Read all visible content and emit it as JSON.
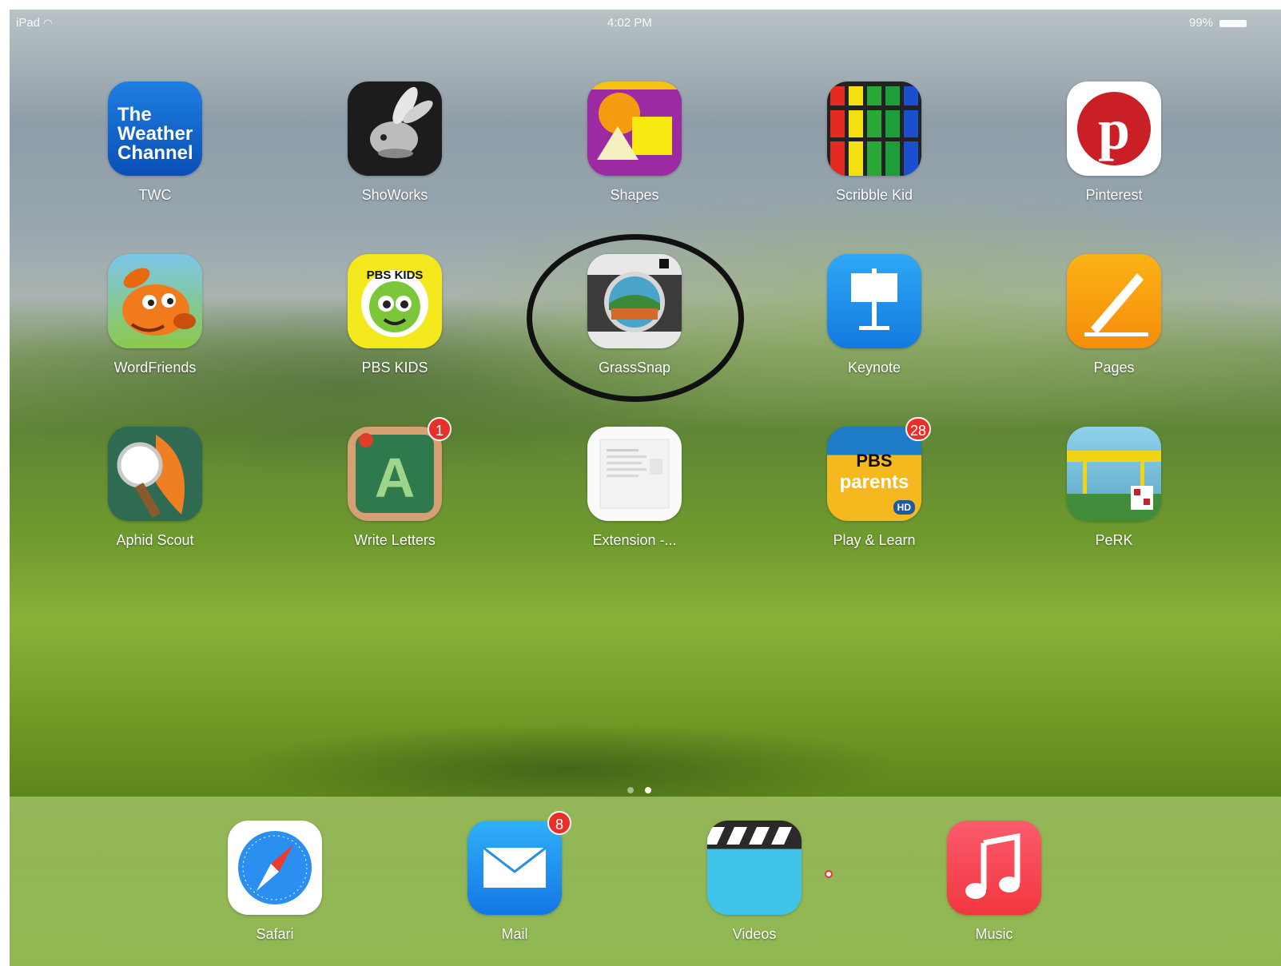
{
  "status_bar": {
    "device": "iPad",
    "time": "4:02 PM",
    "battery": "99%"
  },
  "apps": [
    {
      "label": "TWC",
      "icon_text": [
        "The",
        "Weather",
        "Channel"
      ]
    },
    {
      "label": "ShoWorks"
    },
    {
      "label": "Shapes"
    },
    {
      "label": "Scribble Kid"
    },
    {
      "label": "Pinterest"
    },
    {
      "label": "WordFriends"
    },
    {
      "label": "PBS KIDS",
      "icon_text": "PBS KIDS"
    },
    {
      "label": "GrassSnap"
    },
    {
      "label": "Keynote"
    },
    {
      "label": "Pages"
    },
    {
      "label": "Aphid Scout"
    },
    {
      "label": "Write Letters",
      "badge": "1",
      "icon_text": "A"
    },
    {
      "label": "Extension -..."
    },
    {
      "label": "Play & Learn",
      "badge": "28",
      "icon_text": [
        "PBS",
        "parents",
        "HD"
      ]
    },
    {
      "label": "PeRK"
    }
  ],
  "dock": [
    {
      "label": "Safari"
    },
    {
      "label": "Mail",
      "badge": "8"
    },
    {
      "label": "Videos"
    },
    {
      "label": "Music"
    }
  ],
  "page_indicator": {
    "pages": 2,
    "current": 2
  },
  "colors": {
    "badge": "#e8302a",
    "highlight": "#111111"
  }
}
